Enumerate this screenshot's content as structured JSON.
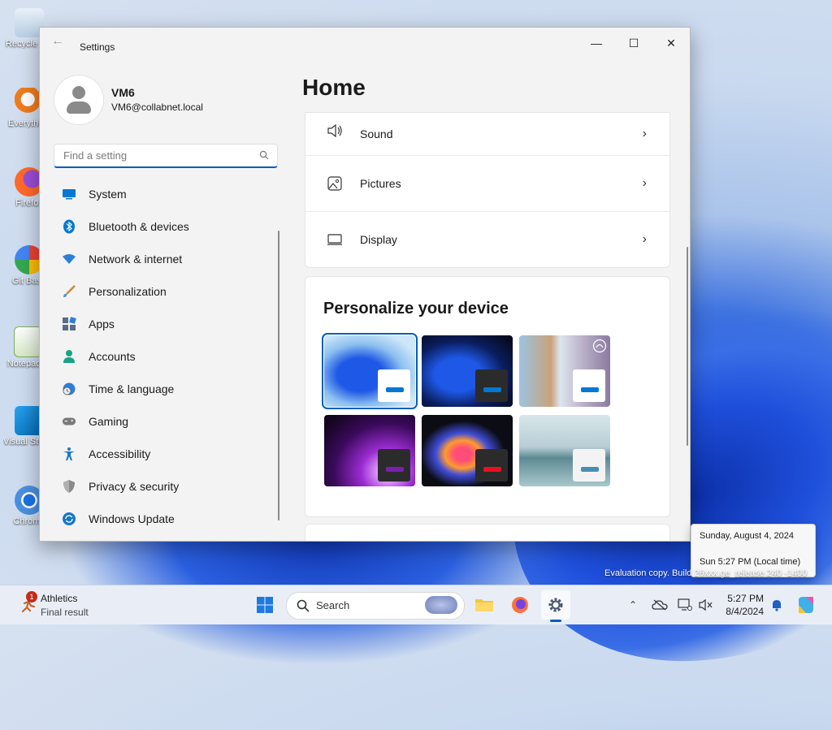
{
  "desktop": {
    "icons": [
      {
        "label": "Recycle Bin"
      },
      {
        "label": "Everything"
      },
      {
        "label": "Firefox"
      },
      {
        "label": "Git Bash"
      },
      {
        "label": "Notepad++"
      },
      {
        "label": "Visual Studio Code"
      },
      {
        "label": "Chrome"
      }
    ]
  },
  "window": {
    "title": "Settings",
    "controls": {
      "minimize": "—",
      "maximize": "☐",
      "close": "✕"
    }
  },
  "user": {
    "name": "VM6",
    "email": "VM6@collabnet.local"
  },
  "search": {
    "placeholder": "Find a setting"
  },
  "nav": {
    "items": [
      {
        "label": "System",
        "icon": "system-icon",
        "color": "#0078d4"
      },
      {
        "label": "Bluetooth & devices",
        "icon": "bluetooth-icon",
        "color": "#0078d4"
      },
      {
        "label": "Network & internet",
        "icon": "wifi-icon",
        "color": "#2b7fd6"
      },
      {
        "label": "Personalization",
        "icon": "brush-icon",
        "color": "#c78a3b"
      },
      {
        "label": "Apps",
        "icon": "apps-icon",
        "color": "#5a6c85"
      },
      {
        "label": "Accounts",
        "icon": "accounts-icon",
        "color": "#1aa383"
      },
      {
        "label": "Time & language",
        "icon": "clock-globe-icon",
        "color": "#2b7fd6"
      },
      {
        "label": "Gaming",
        "icon": "gamepad-icon",
        "color": "#6c6c6c"
      },
      {
        "label": "Accessibility",
        "icon": "accessibility-icon",
        "color": "#1677c9"
      },
      {
        "label": "Privacy & security",
        "icon": "shield-icon",
        "color": "#7a7a7a"
      },
      {
        "label": "Windows Update",
        "icon": "update-icon",
        "color": "#1677c9"
      }
    ]
  },
  "main": {
    "title": "Home",
    "rows": [
      {
        "label": "Sound",
        "icon": "speaker-icon"
      },
      {
        "label": "Pictures",
        "icon": "pictures-icon"
      },
      {
        "label": "Display",
        "icon": "display-icon"
      }
    ],
    "personalize": {
      "title": "Personalize your device"
    }
  },
  "flyout": {
    "date": "Sunday, August 4, 2024",
    "time": "Sun 5:27 PM (Local time)"
  },
  "watermark": "Evaluation copy. Build 26xxx.ge_release.240 -1400",
  "taskbar": {
    "widget": {
      "badge": "1",
      "title": "Athletics",
      "subtitle": "Final result"
    },
    "search_label": "Search",
    "clock": {
      "time": "5:27 PM",
      "date": "8/4/2024"
    }
  }
}
